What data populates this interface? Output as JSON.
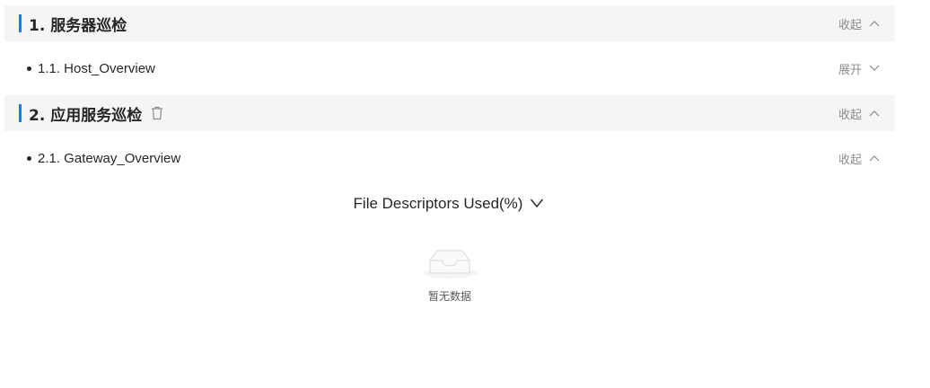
{
  "sections": [
    {
      "title": "1. 服务器巡检",
      "toggle_label": "收起",
      "toggle_state": "expanded",
      "subitems": [
        {
          "label": "1.1. Host_Overview",
          "toggle_label": "展开",
          "toggle_state": "collapsed"
        }
      ]
    },
    {
      "title": "2. 应用服务巡检",
      "toggle_label": "收起",
      "toggle_state": "expanded",
      "has_delete_icon": true,
      "subitems": [
        {
          "label": "2.1. Gateway_Overview",
          "toggle_label": "收起",
          "toggle_state": "expanded"
        }
      ]
    }
  ],
  "chart_panel": {
    "title": "File Descriptors Used(%)",
    "empty_text": "暂无数据"
  },
  "colors": {
    "accent": "#1677ff",
    "header_bg": "#f5f5f5",
    "muted_text": "#8c8c8c"
  },
  "icons": {
    "chevron_up": "chevron-up-icon",
    "chevron_down": "chevron-down-icon",
    "delete": "trash-icon",
    "empty": "empty-inbox-icon"
  }
}
